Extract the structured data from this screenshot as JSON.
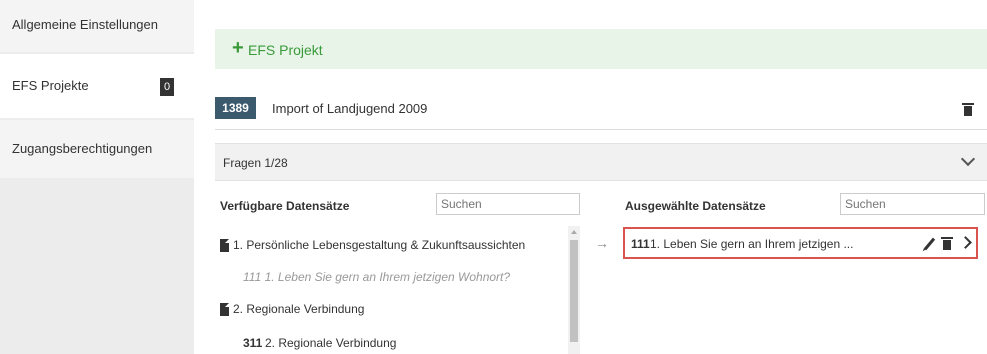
{
  "sidebar": {
    "items": [
      {
        "label": "Allgemeine Einstellungen"
      },
      {
        "label": "EFS Projekte",
        "badge": "0"
      },
      {
        "label": "Zugangsberechtigungen"
      }
    ]
  },
  "add_project": {
    "icon": "plus-icon",
    "label": "EFS Projekt"
  },
  "project": {
    "id": "1389",
    "title": "Import of Landjugend 2009"
  },
  "fragen": {
    "label": "Fragen  1/28"
  },
  "available": {
    "heading": "Verfügbare Datensätze",
    "search_placeholder": "Suchen",
    "items": [
      {
        "type": "group",
        "text": "1. Persönliche Lebensgestaltung & Zukunftsaussichten"
      },
      {
        "type": "muted",
        "text": "111  1. Leben Sie gern an Ihrem jetzigen Wohnort?"
      },
      {
        "type": "group",
        "text": "2. Regionale Verbindung"
      },
      {
        "type": "item",
        "num": "311",
        "text": "2. Regionale Verbindung"
      }
    ]
  },
  "selected": {
    "heading": "Ausgewählte Datensätze",
    "search_placeholder": "Suchen",
    "items": [
      {
        "num": "111",
        "text": "1. Leben Sie gern an Ihrem jetzigen ..."
      }
    ]
  },
  "colors": {
    "accent_green": "#3a9a3a",
    "id_badge": "#3c5a6e",
    "highlight_border": "#d9534f"
  }
}
